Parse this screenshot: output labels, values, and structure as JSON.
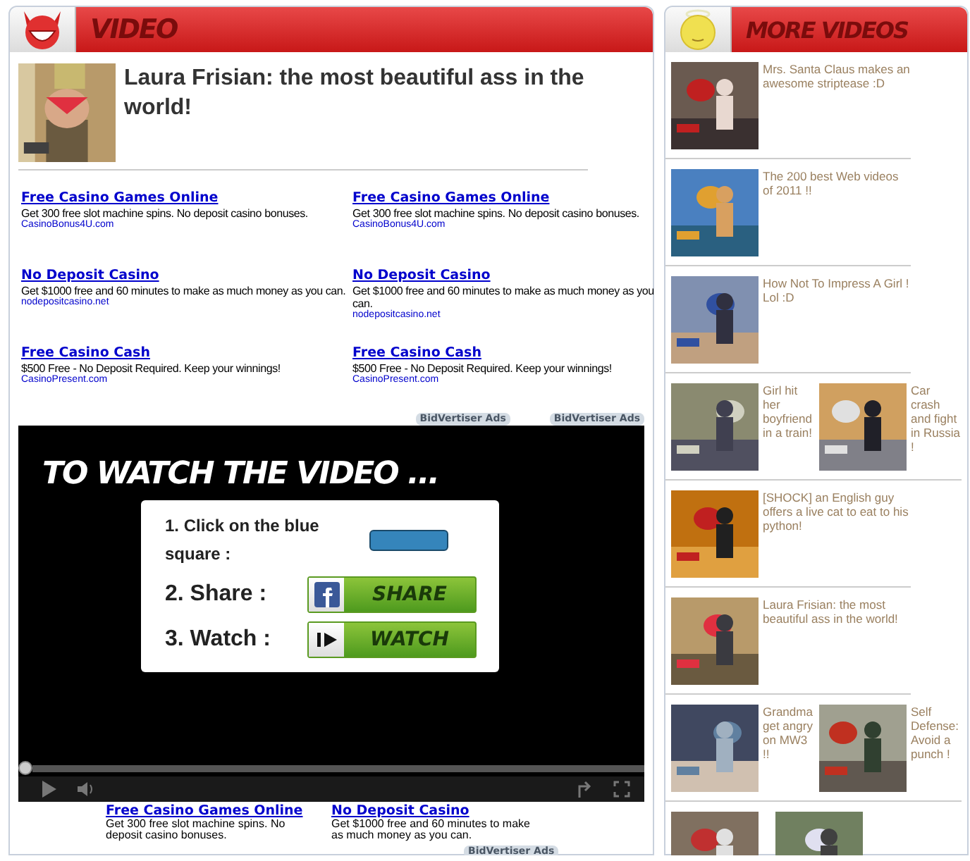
{
  "main": {
    "title": "VIDEO",
    "featured": {
      "title": "Laura Frisian: the most beautiful ass in the world!"
    },
    "ads": [
      {
        "title": "Free Casino Games Online",
        "text": "Get 300 free slot machine spins. No deposit casino bonuses.",
        "url": "CasinoBonus4U.com"
      },
      {
        "title": "Free Casino Games Online",
        "text": "Get 300 free slot machine spins. No deposit casino bonuses.",
        "url": "CasinoBonus4U.com"
      },
      {
        "title": "No Deposit Casino",
        "text": "Get $1000 free and 60 minutes to make as much money as you can.",
        "url": "nodepositcasino.net"
      },
      {
        "title": "No Deposit Casino",
        "text": "Get $1000 free and 60 minutes to make as much money as you can.",
        "url": "nodepositcasino.net"
      },
      {
        "title": "Free Casino Cash",
        "text": "$500 Free - No Deposit Required. Keep your winnings!",
        "url": "CasinoPresent.com"
      },
      {
        "title": "Free Casino Cash",
        "text": "$500 Free - No Deposit Required. Keep your winnings!",
        "url": "CasinoPresent.com"
      }
    ],
    "ad_labels": [
      "BidVertiser Ads",
      "BidVertiser Ads"
    ],
    "player": {
      "heading": "TO WATCH THE VIDEO ...",
      "level": 0,
      "steps": [
        {
          "kind": "blue",
          "label": "1. Click on the blue square :"
        },
        {
          "kind": "share",
          "label": "2. Share :",
          "button": "SHARE"
        },
        {
          "kind": "watch",
          "label": "3. Watch :",
          "button": "WATCH"
        }
      ]
    },
    "bottom_ads": [
      {
        "title": "Free Casino Games Online",
        "text": "Get 300 free slot machine spins. No deposit casino bonuses."
      },
      {
        "title": "No Deposit Casino",
        "text": "Get $1000 free and 60 minutes to make as much money as you can."
      }
    ],
    "bottom_ad_label": "BidVertiser Ads"
  },
  "side": {
    "title": "MORE VIDEOS",
    "rows": [
      {
        "items": [
          {
            "title": "Mrs. Santa Claus makes an awesome striptease :D"
          }
        ]
      },
      {
        "items": [
          {
            "title": "The 200 best Web videos of 2011 !!"
          }
        ]
      },
      {
        "items": [
          {
            "title": "How Not To Impress A Girl ! Lol :D"
          }
        ]
      },
      {
        "items": [
          {
            "title": "Girl hit her boyfriend in a train!"
          },
          {
            "title": "Car crash and fight in Russia !"
          }
        ]
      },
      {
        "items": [
          {
            "title": "[SHOCK] an English guy offers a live cat to eat to his python!"
          }
        ]
      },
      {
        "items": [
          {
            "title": "Laura Frisian: the most beautiful ass in the world!"
          }
        ]
      },
      {
        "items": [
          {
            "title": "Grandma get angry on MW3 !!"
          },
          {
            "title": "Self Defense: Avoid a punch !"
          }
        ]
      },
      {
        "items": [
          {
            "kind": "picture"
          },
          {
            "kind": "picture"
          }
        ]
      }
    ]
  }
}
